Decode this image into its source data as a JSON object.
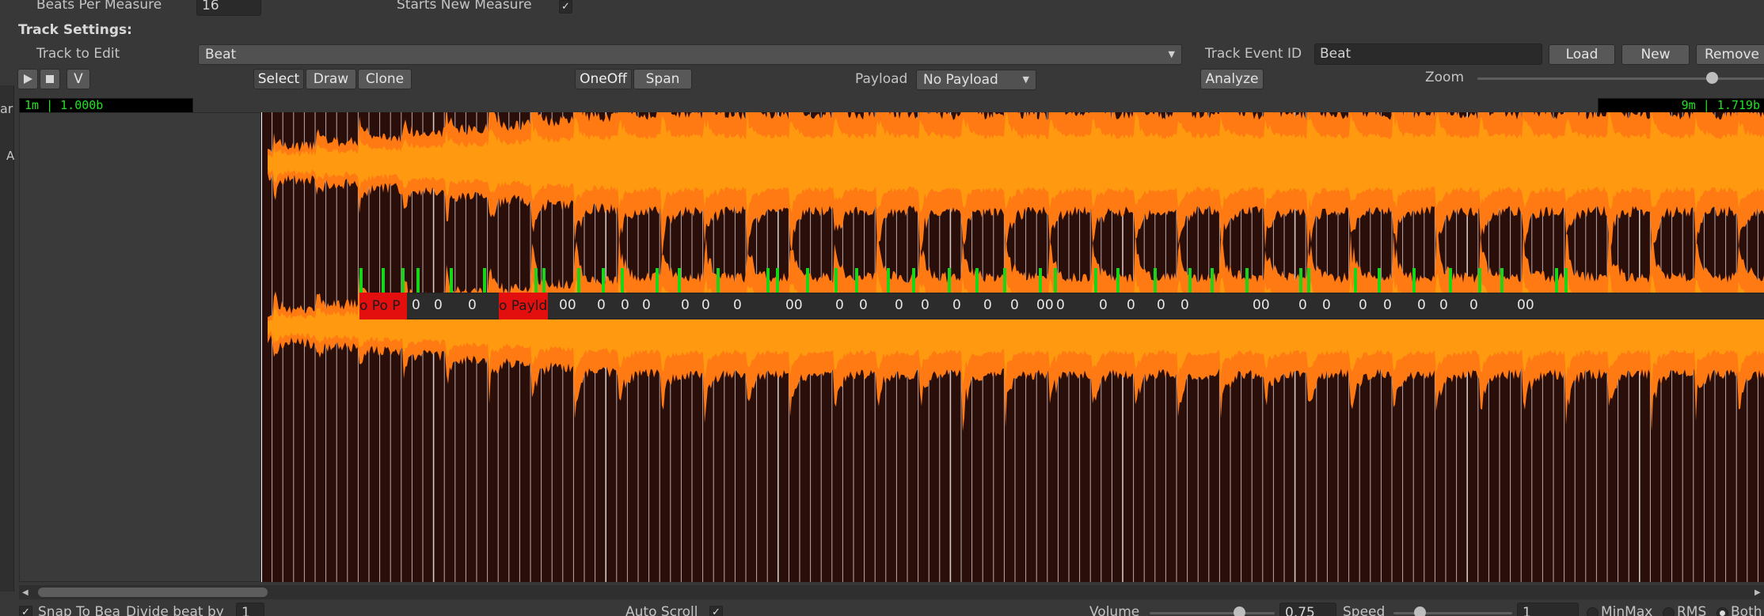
{
  "header": {
    "beats_per_measure_label": "Beats Per Measure",
    "beats_per_measure_value": "16",
    "starts_new_measure_label": "Starts New Measure",
    "starts_new_measure_checked": "✓",
    "track_settings_label": "Track Settings:",
    "track_to_edit_label": "Track to Edit",
    "track_to_edit_value": "Beat",
    "track_event_id_label": "Track Event ID",
    "track_event_id_value": "Beat",
    "load_label": "Load",
    "new_label": "New",
    "remove_label": "Remove"
  },
  "toolbar": {
    "v_label": "V",
    "select_label": "Select",
    "draw_label": "Draw",
    "clone_label": "Clone",
    "oneoff_label": "OneOff",
    "span_label": "Span",
    "payload_label": "Payload",
    "payload_value": "No Payload",
    "analyze_label": "Analyze",
    "zoom_label": "Zoom",
    "zoom_level": 0.82
  },
  "timeline": {
    "start_readout": "1m | 1.000b",
    "end_readout": "9m | 1.719b"
  },
  "left_edge": {
    "fragments": [
      "ar",
      "A"
    ]
  },
  "events": {
    "payload_events": [
      "o Po P",
      "o Payld"
    ],
    "zero_labels": [
      "0",
      "0",
      "0",
      "00",
      "0",
      "0",
      "0",
      "0",
      "0",
      "0",
      "00",
      "0",
      "0",
      "0",
      "0",
      "0",
      "0",
      "0",
      "00",
      "0",
      "0",
      "0",
      "0",
      "0",
      "00",
      "0",
      "0",
      "0",
      "0",
      "0",
      "0",
      "0",
      "00"
    ]
  },
  "footer": {
    "snap_label": "Snap To Bea",
    "snap_checked": "✓",
    "divide_label": "Divide beat by",
    "divide_value": "1",
    "auto_scroll_label": "Auto Scroll",
    "auto_scroll_checked": "✓",
    "volume_label": "Volume",
    "volume_value": "0.75",
    "speed_label": "Speed",
    "speed_value": "1",
    "minmax_label": "MinMax",
    "rms_label": "RMS",
    "both_label": "Both"
  },
  "colors": {
    "background": "#383838",
    "wave_bg": "#2a0e0a",
    "wave_outer": "#ff7a12",
    "wave_inner": "#ff9a10",
    "event_red": "#e30f0f",
    "beat_marker": "#17d617",
    "readout_text": "#21e021"
  }
}
